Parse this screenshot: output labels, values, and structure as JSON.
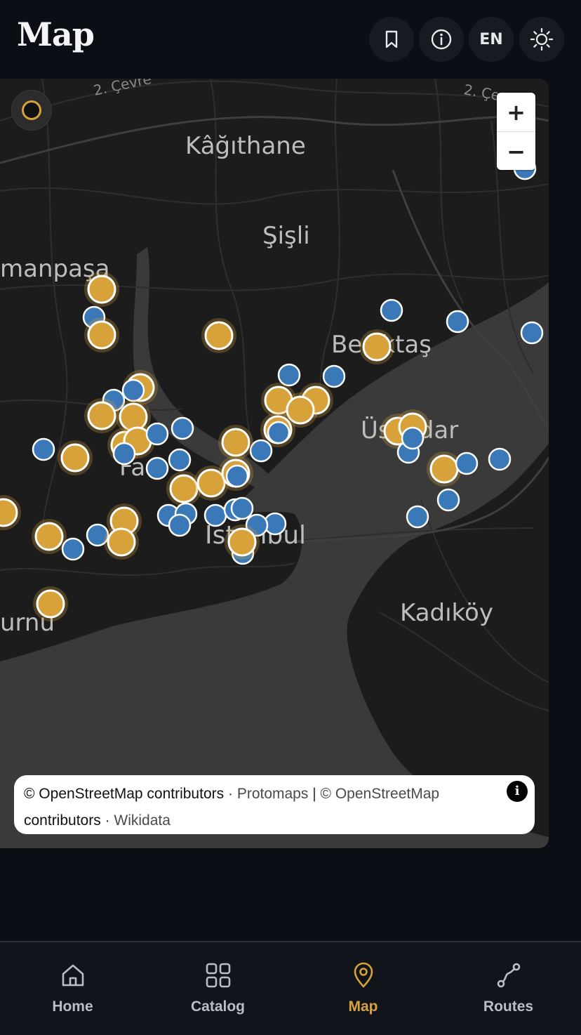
{
  "header": {
    "title": "Map",
    "lang_label": "EN",
    "icons": [
      "bookmark-icon",
      "info-icon",
      "sun-icon"
    ]
  },
  "map": {
    "place_labels": [
      "2. Çevre",
      "2. Çe",
      "Kâğıthane",
      "Şişli",
      "manpaşa",
      "Beşiktaş",
      "Üsküdar",
      "İstanbul",
      "Kadıköy",
      "urnu",
      "Fa"
    ],
    "zoom_in_label": "+",
    "zoom_out_label": "−",
    "attribution": {
      "part1_link": "© OpenStreetMap",
      "part1_text": "contributors",
      "sep1": "·",
      "part2_link": "Protomaps",
      "sep2": "|",
      "part3_link": "© OpenStreetMap",
      "part4_text": "contributors",
      "sep3": "·",
      "part5_link": "Wikidata",
      "info_label": "i"
    },
    "colors": {
      "gold_marker": "#d8a23a",
      "blue_marker": "#3a78b8",
      "water": "#3a3a3a",
      "land": "#1c1c1c"
    }
  },
  "nav": {
    "items": [
      {
        "label": "Home",
        "icon": "home-icon"
      },
      {
        "label": "Catalog",
        "icon": "grid-icon"
      },
      {
        "label": "Map",
        "icon": "map-pin-icon",
        "active": true
      },
      {
        "label": "Routes",
        "icon": "route-icon"
      }
    ],
    "active_color": "#d8a23a"
  }
}
